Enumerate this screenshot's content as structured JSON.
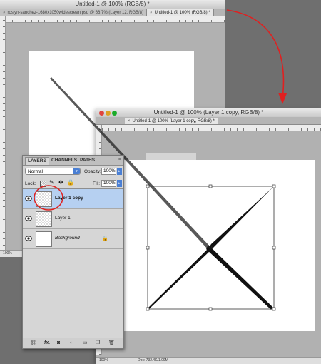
{
  "back_window": {
    "title": "Untitled-1 @ 100% (RGB/8) *",
    "tabs": [
      {
        "label": "roslyn-sanchez-1680x1050widescreen.psd @ 66.7% (Layer 12, RGB/8)"
      },
      {
        "label": "Untitled-1 @ 100% (RGB/8) *"
      }
    ],
    "zoom": "100%"
  },
  "front_window": {
    "title": "Untitled-1 @ 100% (Layer 1 copy, RGB/8) *",
    "tab_label": "Untitled-1 @ 100% (Layer 1 copy, RGB/8) *",
    "zoom": "100%",
    "doc_info": "Doc: 732.4K/1.09M"
  },
  "layers_panel": {
    "tabs": [
      "LAYERS",
      "CHANNELS",
      "PATHS"
    ],
    "blend_mode": "Normal",
    "opacity_label": "Opacity:",
    "opacity_value": "100%",
    "lock_label": "Lock:",
    "fill_label": "Fill:",
    "fill_value": "100%",
    "layers": [
      {
        "name": "Layer 1 copy",
        "selected": true
      },
      {
        "name": "Layer 1",
        "selected": false
      },
      {
        "name": "Background",
        "selected": false,
        "locked": true
      }
    ],
    "footer_icons": [
      "link-icon",
      "fx-icon",
      "mask-icon",
      "adjustment-icon",
      "group-icon",
      "new-layer-icon",
      "trash-icon"
    ],
    "fx_label": "fx."
  },
  "annotation_color": "#e02020",
  "selection_color": "#b6d0f1"
}
